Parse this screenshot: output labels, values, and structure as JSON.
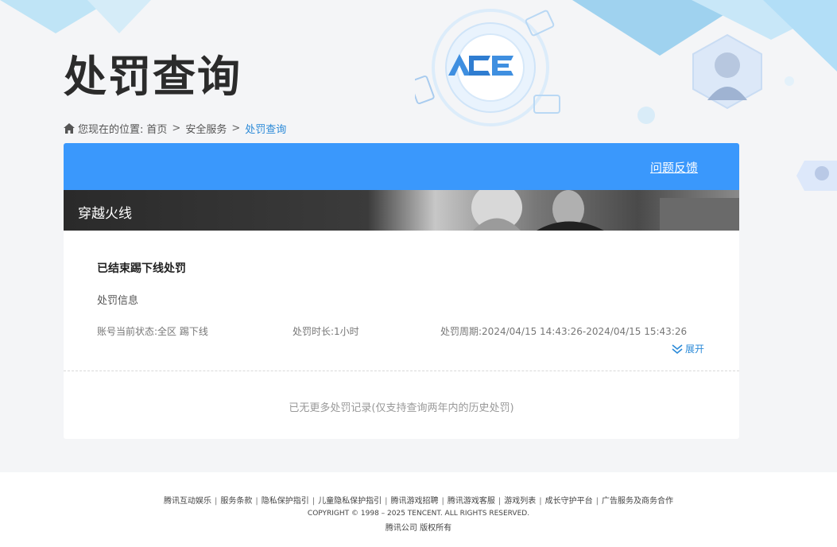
{
  "header": {
    "title": "处罚查询",
    "logo_text": "ACE"
  },
  "breadcrumb": {
    "prefix": "您现在的位置:",
    "items": [
      "首页",
      "安全服务",
      "处罚查询"
    ],
    "separator": ">"
  },
  "panel": {
    "feedback_link": "问题反馈",
    "game_name": "穿越火线"
  },
  "record": {
    "title": "已结束踢下线处罚",
    "subtitle": "处罚信息",
    "account_status": "账号当前状态:全区 踢下线",
    "duration": "处罚时长:1小时",
    "period": "处罚周期:2024/04/15 14:43:26-2024/04/15 15:43:26",
    "expand_label": "展开"
  },
  "no_more": "已无更多处罚记录(仅支持查询两年内的历史处罚)",
  "footer": {
    "links": [
      "腾讯互动娱乐",
      "服务条款",
      "隐私保护指引",
      "儿童隐私保护指引",
      "腾讯游戏招聘",
      "腾讯游戏客服",
      "游戏列表",
      "成长守护平台",
      "广告服务及商务合作"
    ],
    "copyright": "COPYRIGHT © 1998 – 2025 TENCENT. ALL RIGHTS RESERVED.",
    "owner": "腾讯公司 版权所有"
  },
  "colors": {
    "accent": "#3a98fc",
    "link": "#2b8ad8",
    "title": "#2b2b2b"
  },
  "icons": {
    "home": "home-icon",
    "expand": "chevron-double-down-icon"
  }
}
